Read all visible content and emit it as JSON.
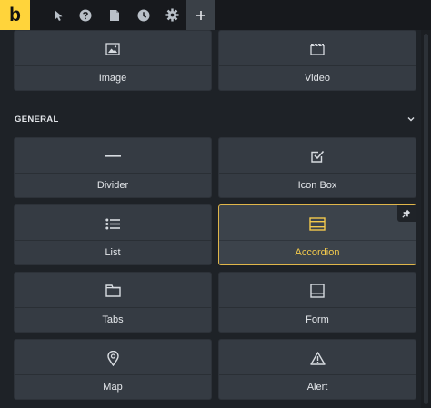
{
  "app": {
    "logo_letter": "b"
  },
  "toolbar": {
    "icons": [
      "cursor-icon",
      "help-icon",
      "page-icon",
      "history-icon",
      "settings-icon",
      "add-icon"
    ],
    "active": "add-icon"
  },
  "colors": {
    "accent": "#ffd43b",
    "card_bg": "#353b43",
    "selected_border": "#e0b64a",
    "selected_text": "#f2c94c"
  },
  "media": {
    "items": [
      {
        "label": "Image",
        "icon": "image-icon"
      },
      {
        "label": "Video",
        "icon": "video-icon"
      }
    ]
  },
  "general": {
    "title": "GENERAL",
    "items": [
      {
        "label": "Divider",
        "icon": "divider-icon"
      },
      {
        "label": "Icon Box",
        "icon": "icon-box-icon"
      },
      {
        "label": "List",
        "icon": "list-icon"
      },
      {
        "label": "Accordion",
        "icon": "accordion-icon",
        "selected": true
      },
      {
        "label": "Tabs",
        "icon": "tabs-icon"
      },
      {
        "label": "Form",
        "icon": "form-icon"
      },
      {
        "label": "Map",
        "icon": "map-pin-icon"
      },
      {
        "label": "Alert",
        "icon": "alert-icon"
      }
    ]
  }
}
